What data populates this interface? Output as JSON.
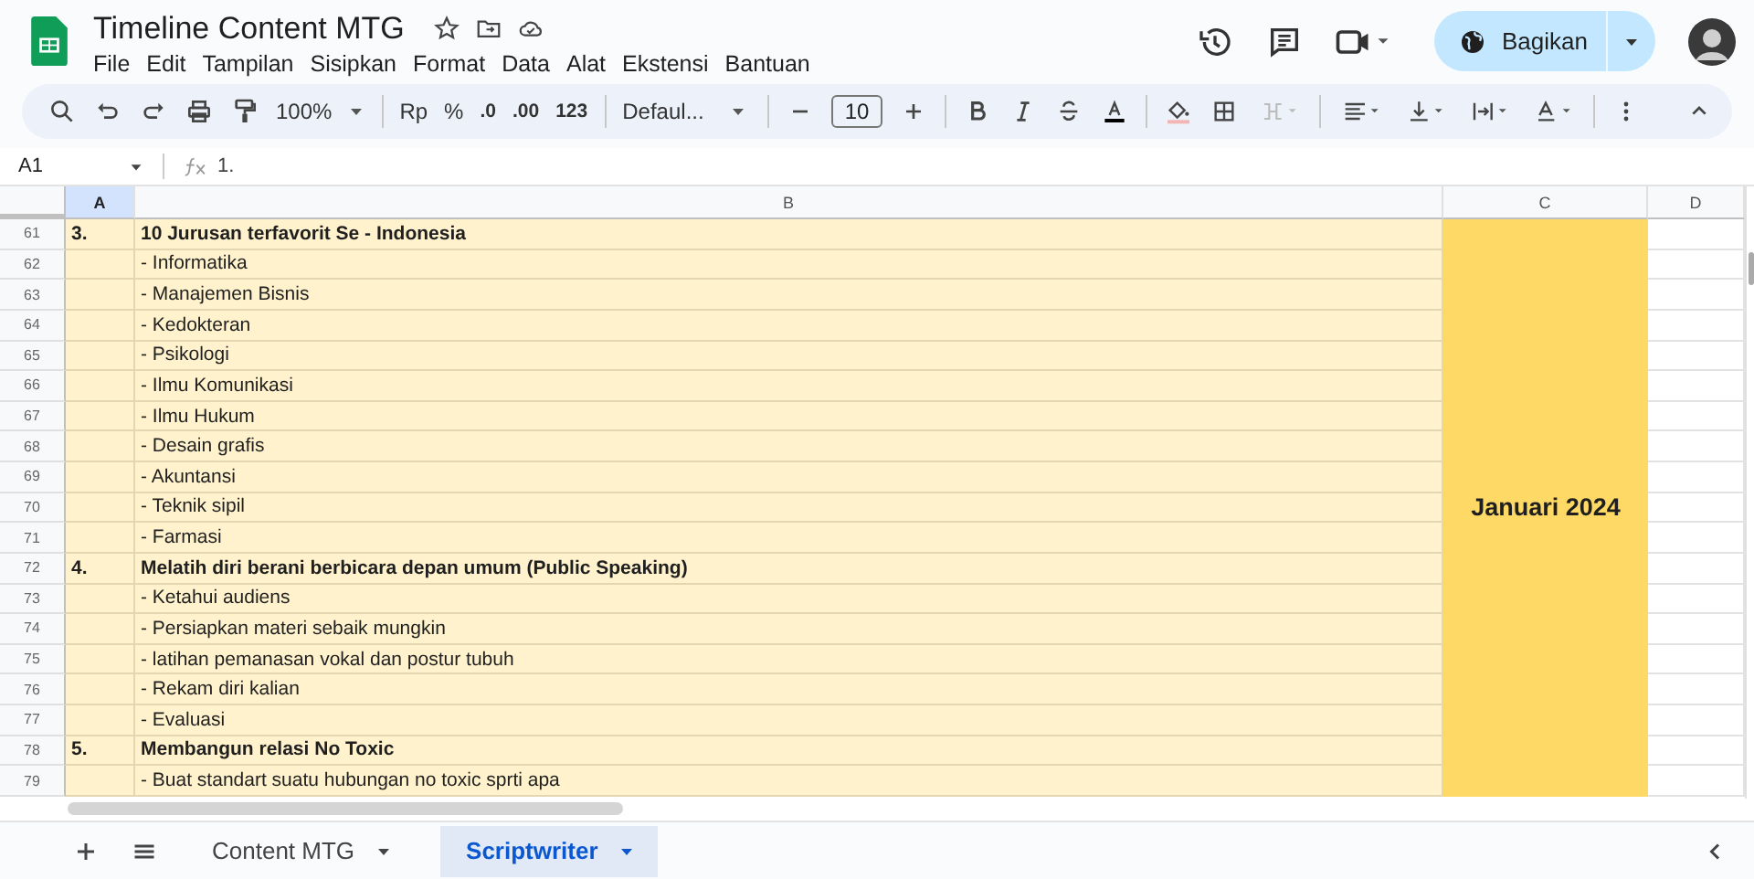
{
  "document": {
    "title": "Timeline Content MTG"
  },
  "menu": [
    "File",
    "Edit",
    "Tampilan",
    "Sisipkan",
    "Format",
    "Data",
    "Alat",
    "Ekstensi",
    "Bantuan"
  ],
  "share_button": {
    "label": "Bagikan"
  },
  "toolbar": {
    "zoom": "100%",
    "currency": "Rp",
    "percent": "%",
    "decrease_decimal": ".0",
    "increase_decimal": ".00",
    "number_format": "123",
    "font": "Defaul...",
    "font_size": "10"
  },
  "formula_bar": {
    "cell_ref": "A1",
    "formula": "1."
  },
  "columns": [
    {
      "label": "A",
      "selected": true
    },
    {
      "label": "B",
      "selected": false
    },
    {
      "label": "C",
      "selected": false
    },
    {
      "label": "D",
      "selected": false
    }
  ],
  "rows": [
    {
      "num": "61",
      "a": "3.",
      "b": "10 Jurusan terfavorit Se - Indonesia",
      "bold": true
    },
    {
      "num": "62",
      "a": "",
      "b": "- Informatika",
      "bold": false
    },
    {
      "num": "63",
      "a": "",
      "b": "- Manajemen Bisnis",
      "bold": false
    },
    {
      "num": "64",
      "a": "",
      "b": "- Kedokteran",
      "bold": false
    },
    {
      "num": "65",
      "a": "",
      "b": "- Psikologi",
      "bold": false
    },
    {
      "num": "66",
      "a": "",
      "b": "- Ilmu Komunikasi",
      "bold": false
    },
    {
      "num": "67",
      "a": "",
      "b": "- Ilmu Hukum",
      "bold": false
    },
    {
      "num": "68",
      "a": "",
      "b": "- Desain grafis",
      "bold": false
    },
    {
      "num": "69",
      "a": "",
      "b": "- Akuntansi",
      "bold": false
    },
    {
      "num": "70",
      "a": "",
      "b": "- Teknik sipil",
      "bold": false
    },
    {
      "num": "71",
      "a": "",
      "b": "- Farmasi",
      "bold": false
    },
    {
      "num": "72",
      "a": "4.",
      "b": "Melatih diri berani berbicara depan umum (Public Speaking)",
      "bold": true
    },
    {
      "num": "73",
      "a": "",
      "b": "- Ketahui audiens",
      "bold": false
    },
    {
      "num": "74",
      "a": "",
      "b": "- Persiapkan materi sebaik mungkin",
      "bold": false
    },
    {
      "num": "75",
      "a": "",
      "b": "- latihan pemanasan vokal dan postur tubuh",
      "bold": false
    },
    {
      "num": "76",
      "a": "",
      "b": "- Rekam diri kalian",
      "bold": false
    },
    {
      "num": "77",
      "a": "",
      "b": "- Evaluasi",
      "bold": false
    },
    {
      "num": "78",
      "a": "5.",
      "b": "Membangun relasi No Toxic",
      "bold": true
    },
    {
      "num": "79",
      "a": "",
      "b": "- Buat standart suatu hubungan no toxic sprti apa",
      "bold": false
    }
  ],
  "merged_cell": {
    "text": "Januari 2024"
  },
  "sheet_tabs": [
    {
      "label": "Content MTG",
      "selected": false
    },
    {
      "label": "Scriptwriter",
      "selected": true
    }
  ]
}
